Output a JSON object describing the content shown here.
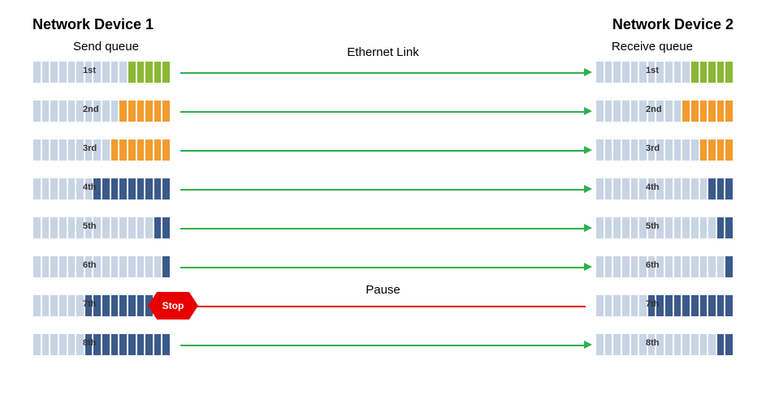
{
  "titles": {
    "left": "Network Device 1",
    "right": "Network Device 2"
  },
  "subtitles": {
    "left": "Send queue",
    "right": "Receive queue"
  },
  "link_label": "Ethernet Link",
  "pause_label": "Pause",
  "stop_label": "Stop",
  "total_cells": 16,
  "rows": [
    {
      "label": "1st",
      "fill_color": "green",
      "left_filled": 5,
      "right_filled": 5,
      "direction": "right"
    },
    {
      "label": "2nd",
      "fill_color": "orange",
      "left_filled": 6,
      "right_filled": 6,
      "direction": "right"
    },
    {
      "label": "3rd",
      "fill_color": "orange",
      "left_filled": 7,
      "right_filled": 4,
      "direction": "right"
    },
    {
      "label": "4th",
      "fill_color": "blue",
      "left_filled": 9,
      "right_filled": 3,
      "direction": "right"
    },
    {
      "label": "5th",
      "fill_color": "blue",
      "left_filled": 2,
      "right_filled": 2,
      "direction": "right"
    },
    {
      "label": "6th",
      "fill_color": "blue",
      "left_filled": 1,
      "right_filled": 1,
      "direction": "right"
    },
    {
      "label": "7th",
      "fill_color": "blue",
      "left_filled": 10,
      "right_filled": 10,
      "direction": "left",
      "stop": true,
      "pause": true
    },
    {
      "label": "8th",
      "fill_color": "blue",
      "left_filled": 10,
      "right_filled": 2,
      "direction": "right"
    }
  ]
}
